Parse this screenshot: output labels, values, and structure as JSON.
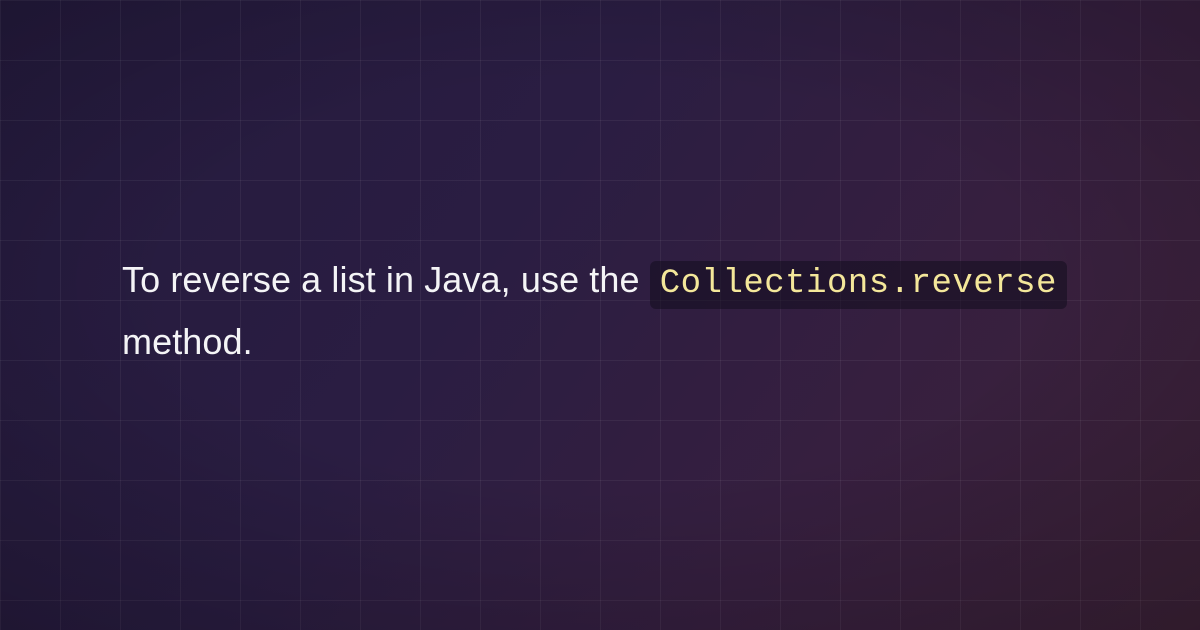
{
  "sentence": {
    "part1": "To reverse a list in Java, use the ",
    "code": "Collections.reverse",
    "part2": " method."
  }
}
